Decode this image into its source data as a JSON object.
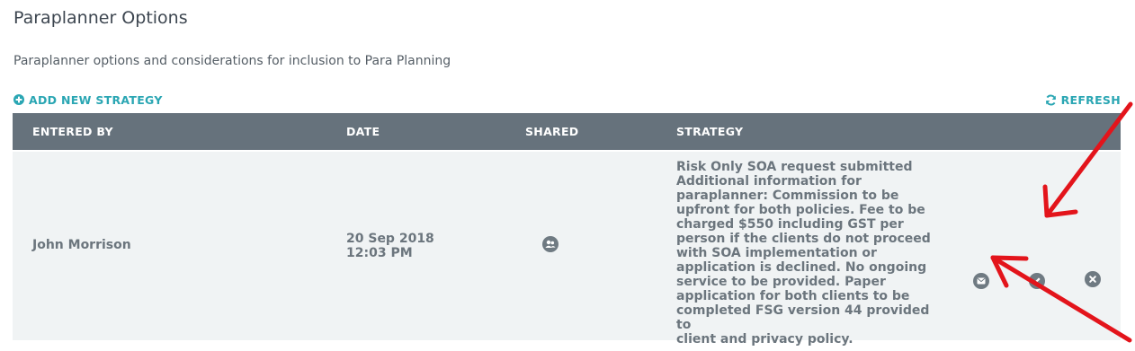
{
  "page": {
    "title": "Paraplanner Options",
    "description": "Paraplanner options and considerations for inclusion to Para Planning"
  },
  "toolbar": {
    "add_label": "ADD NEW STRATEGY",
    "refresh_label": "REFRESH"
  },
  "table": {
    "columns": [
      "ENTERED BY",
      "DATE",
      "SHARED",
      "STRATEGY"
    ],
    "rows": [
      {
        "entered_by": "John Morrison",
        "date_line1": "20 Sep 2018",
        "date_line2": "12:03 PM",
        "shared_icon": "shared-users-icon",
        "strategy_lines": [
          "Risk Only SOA request submitted",
          "Additional information for",
          "paraplanner: Commission to be",
          "upfront for both policies. Fee to be",
          "charged $550 including GST per",
          "person if the clients do not proceed",
          "with SOA implementation or",
          "application is declined. No ongoing",
          "service to be provided. Paper",
          "application for both clients to be",
          "completed FSG version 44 provided to",
          "client and privacy policy."
        ],
        "actions": [
          "email-icon",
          "edit-icon",
          "delete-icon"
        ]
      }
    ]
  },
  "colors": {
    "accent": "#2aa6b3",
    "header_bg": "#66727c",
    "row_bg": "#f0f3f4",
    "annotation_arrow": "#e3141b"
  }
}
